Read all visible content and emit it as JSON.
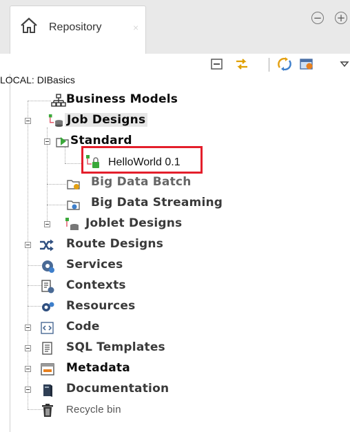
{
  "tab": {
    "title": "Repository",
    "close": "×",
    "icon": "home-icon"
  },
  "window_buttons": {
    "minimize": "−",
    "maximize": "+"
  },
  "toolbar": {
    "buttons": [
      "collapse-all-icon",
      "link-editor-icon",
      "refresh-icon",
      "filter-icon",
      "view-menu-icon"
    ]
  },
  "project": {
    "label": "LOCAL: DIBasics"
  },
  "tree": {
    "business_models": "Business Models",
    "job_designs": "Job Designs",
    "standard": "Standard",
    "hello_world": "HelloWorld 0.1",
    "big_data_batch": "Big Data Batch",
    "big_data_streaming": "Big Data Streaming",
    "joblet_designs": "Joblet Designs",
    "route_designs": "Route Designs",
    "services": "Services",
    "contexts": "Contexts",
    "resources": "Resources",
    "code": "Code",
    "sql_templates": "SQL Templates",
    "metadata": "Metadata",
    "documentation": "Documentation",
    "recycle_bin": "Recycle bin"
  },
  "colors": {
    "selection_border": "#e41e2b",
    "job_green": "#3aa83a",
    "tab_bg": "#e9e9e9"
  }
}
